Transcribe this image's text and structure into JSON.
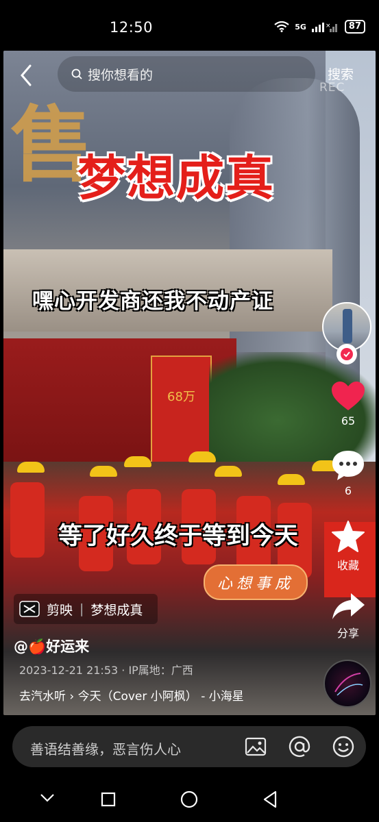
{
  "status_bar": {
    "time": "12:50",
    "network": "5G",
    "battery": "87"
  },
  "search": {
    "placeholder": "搜你想看的",
    "button": "搜索"
  },
  "video": {
    "rec_label": "REC",
    "headline": "梦想成真",
    "caption_top": "嘿心开发商还我不动产证",
    "caption_middle": "等了好久终于等到今天",
    "sticker": "心想事成",
    "sign_text": "售",
    "pillar_text": "68万"
  },
  "actions": {
    "likes": "65",
    "comments": "6",
    "favorite_label": "收藏",
    "share_label": "分享"
  },
  "info": {
    "capcut_app": "剪映",
    "capcut_template": "梦想成真",
    "author": "@🍎好运来",
    "meta": "2023-12-21 21:53 · IP属地：广西",
    "music": "去汽水听 › 今天（Cover 小阿枫） - 小海星"
  },
  "comment_bar": {
    "placeholder": "善语结善缘，恶言伤人心"
  }
}
